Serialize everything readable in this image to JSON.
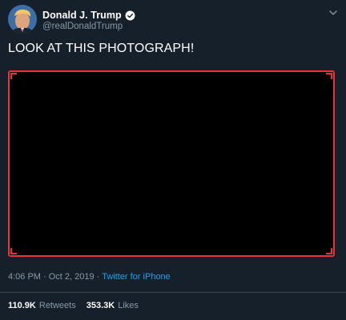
{
  "author": {
    "display_name": "Donald J. Trump",
    "handle": "@realDonaldTrump",
    "verified": true,
    "avatar_icon": "profile-photo",
    "verified_icon": "verified-badge-icon"
  },
  "tweet": {
    "text": "LOOK AT THIS PHOTOGRAPH!",
    "media": {
      "fill_color": "#000000",
      "border_color": "#e8323c"
    }
  },
  "meta": {
    "time": "4:06 PM",
    "separator1": " · ",
    "date": "Oct 2, 2019",
    "separator2": " · ",
    "source": "Twitter for iPhone"
  },
  "stats": {
    "retweets_count": "110.9K",
    "retweets_label": "Retweets",
    "likes_count": "353.3K",
    "likes_label": "Likes"
  },
  "colors": {
    "background": "#15202b",
    "text_secondary": "#8899a6",
    "link": "#1da1f2",
    "divider": "#38444d"
  }
}
